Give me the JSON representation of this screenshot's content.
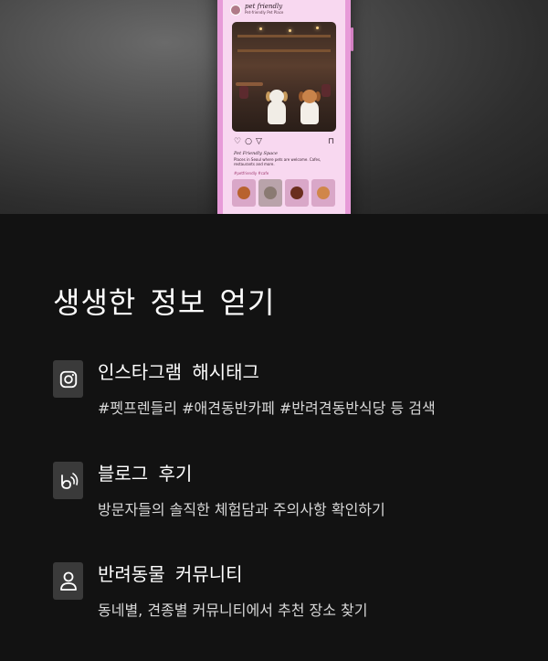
{
  "hero": {
    "post_user": "pet friendly",
    "post_location": "Pet-friendly Pet Place",
    "caption_title": "Pet Friendly Space",
    "caption_body": "Places in Seoul where pets are welcome. Cafes, restaurants and more.",
    "caption_tags": "#petfriendly #cafe"
  },
  "section": {
    "heading": "생생한 정보 얻기",
    "features": [
      {
        "icon": "instagram-icon",
        "title": "인스타그램 해시태그",
        "desc": "#펫프렌들리 #애견동반카페 #반려견동반식당 등 검색"
      },
      {
        "icon": "blog-icon",
        "title": "블로그 후기",
        "desc": "방문자들의 솔직한 체험담과 주의사항 확인하기"
      },
      {
        "icon": "person-icon",
        "title": "반려동물 커뮤니티",
        "desc": "동네별, 견종별 커뮤니티에서 추천 장소 찾기"
      }
    ]
  }
}
